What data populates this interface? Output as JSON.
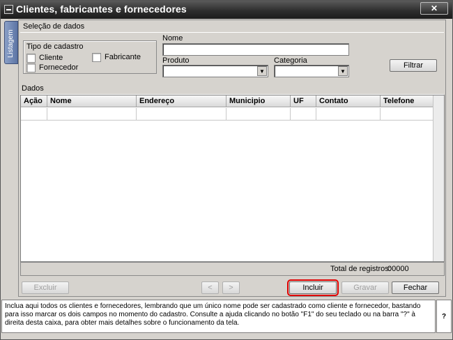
{
  "window": {
    "title": "Clientes, fabricantes e fornecedores",
    "close": "✕"
  },
  "side_tab": "Listagem",
  "selecao": {
    "title": "Seleção de dados",
    "tipo_cadastro": {
      "title": "Tipo de cadastro",
      "cliente": "Cliente",
      "fabricante": "Fabricante",
      "fornecedor": "Fornecedor"
    },
    "nome_label": "Nome",
    "produto_label": "Produto",
    "categoria_label": "Categoria",
    "filtrar": "Filtrar"
  },
  "dados": {
    "title": "Dados",
    "columns": [
      "Ação",
      "Nome",
      "Endereço",
      "Municipio",
      "UF",
      "Contato",
      "Telefone"
    ],
    "total_label": "Total de registros:",
    "total_value": "00000"
  },
  "buttons": {
    "excluir": "Excluir",
    "prev": "<",
    "next": ">",
    "incluir": "Incluir",
    "gravar": "Gravar",
    "fechar": "Fechar"
  },
  "help": {
    "text": "Inclua aqui todos os clientes e fornecedores, lembrando que um único nome pode ser cadastrado como cliente e fornecedor, bastando para isso marcar os dois campos no momento do cadastro. Consulte a ajuda clicando no botão \"F1\" do seu teclado ou na barra \"?\" à direita desta caixa, para obter mais detalhes sobre o funcionamento da tela.",
    "qmark": "?"
  },
  "colors": {
    "highlight": "#e00000",
    "titlebar": "#2e2e2e",
    "side_tab": "#5c74a4"
  }
}
